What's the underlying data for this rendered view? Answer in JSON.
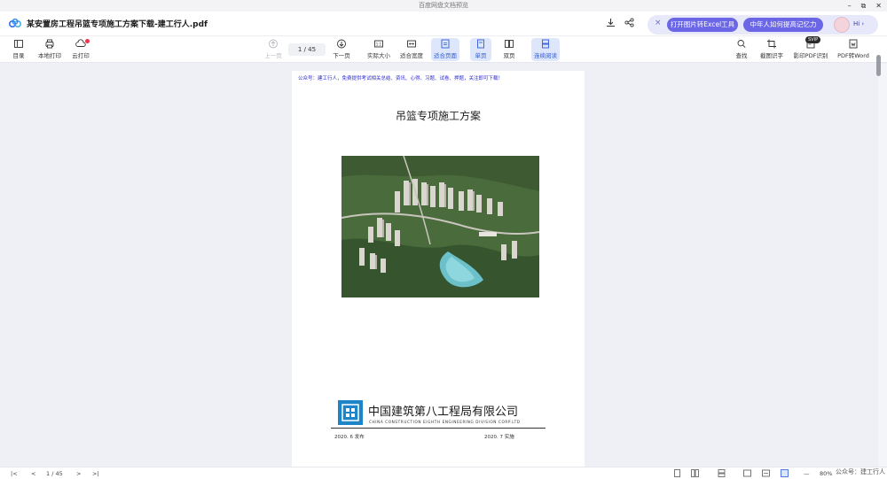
{
  "os_bar": {
    "title": "百度网盘文档预览",
    "min": "–",
    "restore": "⧉",
    "close": "✕"
  },
  "header": {
    "title": "某安置房工程吊篮专项施工方案下载-建工行人.pdf",
    "promo_close": "×",
    "promo_btn1": "打开图片转Excel工具",
    "promo_btn2": "中年人如何提高记忆力",
    "hi": "Hi ›"
  },
  "toolbar": {
    "catalog": "目录",
    "local_print": "本地打印",
    "cloud_print": "云打印",
    "prev_page": "上一页",
    "page_indicator": "1 / 45",
    "next_page": "下一页",
    "actual_size": "实际大小",
    "fit_width": "适合宽度",
    "fit_page": "适合页面",
    "single": "单页",
    "double": "双页",
    "continuous": "连续阅读",
    "search": "查找",
    "ocr": "截图识字",
    "scan_pdf": "影印PDF识别",
    "pdf_word": "PDF转Word",
    "trial_badge": "SVIP"
  },
  "page": {
    "notice": "公众号：建工行人，免费提供考试相关总结、资讯、心得、习题、试卷、押题，关注即可下载！",
    "title": "吊篮专项施工方案",
    "company_cn": "中国建筑第八工程局有限公司",
    "company_en": "CHINA CONSTRUCTION EIGHTH ENGINEERING DIVISION CORP.LTD",
    "date_left": "2020. 6 发布",
    "date_right": "2020. 7 实施"
  },
  "bottom": {
    "first": "|<",
    "prev": "<",
    "page": "1 / 45",
    "next": ">",
    "last": ">|",
    "zoom_minus": "—",
    "zoom": "80%",
    "watermark": "公众号：建工行人"
  }
}
